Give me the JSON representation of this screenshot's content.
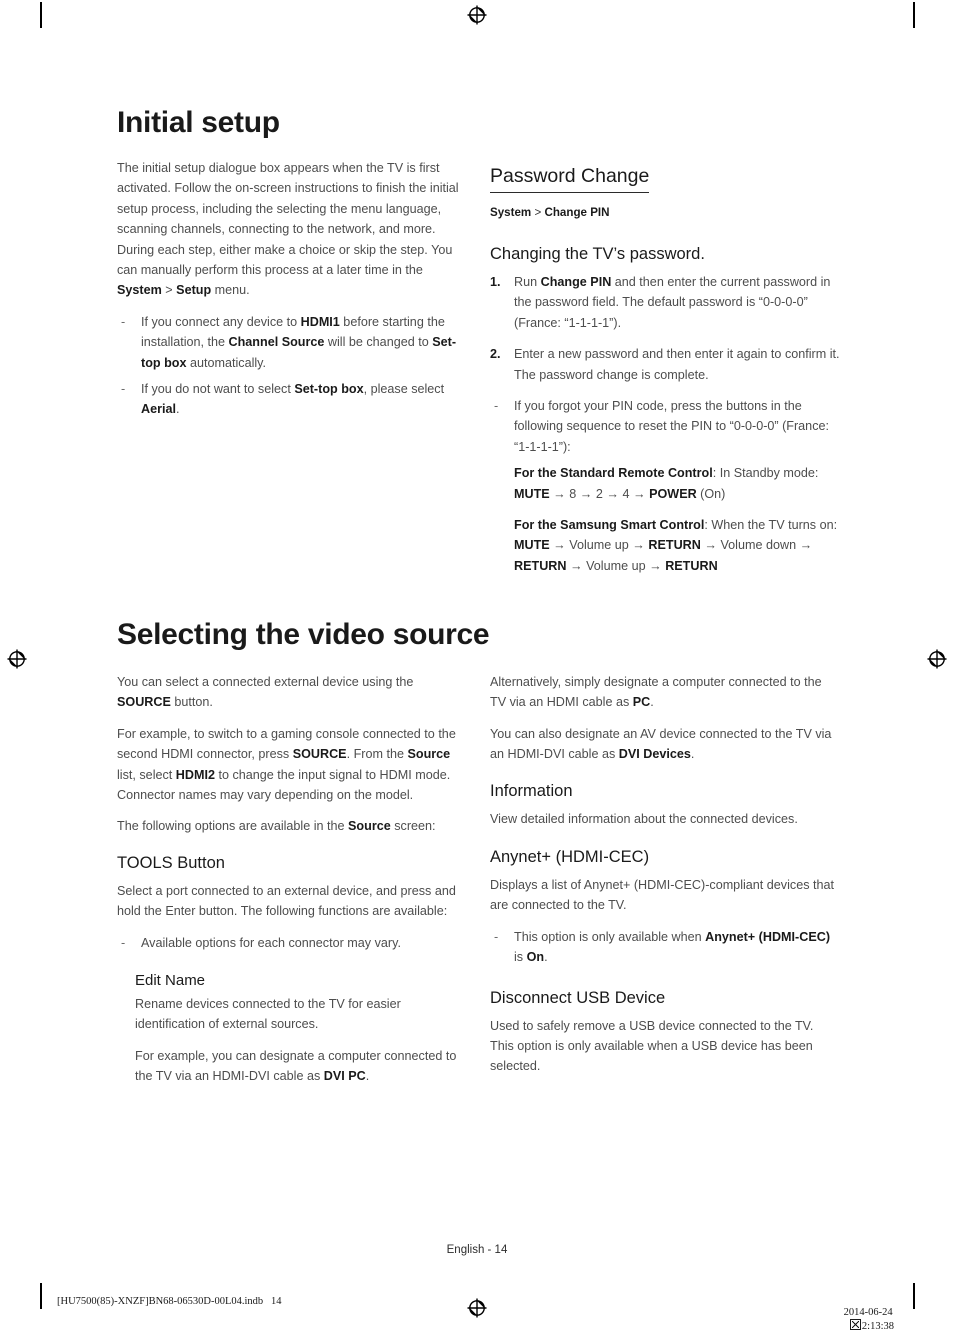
{
  "page": {
    "folio": "English - 14",
    "slug_left": "[HU7500(85)-XNZF]BN68-06530D-00L04.indb   14",
    "slug_right_date": "2014-06-24",
    "slug_right_time": "2:13:38"
  },
  "chapter1": {
    "title": "Initial setup",
    "intro": "The initial setup dialogue box appears when the TV is first activated. Follow the on-screen instructions to finish the initial setup process, including the selecting the menu language, scanning channels, connecting to the network, and more. During each step, either make a choice or skip the step. You can manually perform this process at a later time in the ",
    "intro_menu_1": "System",
    "intro_gt": " > ",
    "intro_menu_2": "Setup",
    "intro_tail": " menu.",
    "bullets": [
      {
        "marker": "-",
        "parts": [
          {
            "t": "If you connect any device to ",
            "b": false
          },
          {
            "t": "HDMI1",
            "b": true
          },
          {
            "t": " before starting the installation, the ",
            "b": false
          },
          {
            "t": "Channel Source",
            "b": true
          },
          {
            "t": " will be changed to ",
            "b": false
          },
          {
            "t": "Set-top box",
            "b": true
          },
          {
            "t": " automatically.",
            "b": false
          }
        ]
      },
      {
        "marker": "-",
        "parts": [
          {
            "t": "If you do not want to select ",
            "b": false
          },
          {
            "t": "Set-top box",
            "b": true
          },
          {
            "t": ", please select ",
            "b": false
          },
          {
            "t": "Aerial",
            "b": true
          },
          {
            "t": ".",
            "b": false
          }
        ]
      }
    ]
  },
  "password_change": {
    "heading": "Password Change",
    "path_root": "System",
    "path_sep": " > ",
    "path_leaf": "Change PIN",
    "sub_heading": "Changing the TV’s password.",
    "steps": [
      {
        "marker": "1.",
        "parts": [
          {
            "t": "Run ",
            "b": false
          },
          {
            "t": "Change PIN",
            "b": true
          },
          {
            "t": " and then enter the current password in the password field. The default password is “0-0-0-0” (France: “1-1-1-1”).",
            "b": false
          }
        ]
      },
      {
        "marker": "2.",
        "parts": [
          {
            "t": "Enter a new password and then enter it again to confirm it. The password change is complete.",
            "b": false
          }
        ]
      }
    ],
    "note": {
      "marker": "-",
      "text": "If you forgot your PIN code, press the buttons in the following sequence to reset the PIN to “0-0-0-0” (France: “1-1-1-1”):"
    },
    "remote_standard": {
      "label": "For the Standard Remote Control",
      "lead": ": In Standby mode:",
      "sequence_parts": [
        {
          "t": "MUTE",
          "b": true
        },
        {
          "t": " → ",
          "b": false
        },
        {
          "t": "8",
          "b": false
        },
        {
          "t": " → ",
          "b": false
        },
        {
          "t": "2",
          "b": false
        },
        {
          "t": " → ",
          "b": false
        },
        {
          "t": "4",
          "b": false
        },
        {
          "t": " → ",
          "b": false
        },
        {
          "t": "POWER",
          "b": true
        },
        {
          "t": " (On)",
          "b": false
        }
      ]
    },
    "remote_smart": {
      "label": "For the Samsung Smart Control",
      "lead": ": When the TV turns on: ",
      "sequence_parts": [
        {
          "t": "MUTE",
          "b": true
        },
        {
          "t": " → ",
          "b": false
        },
        {
          "t": "Volume up",
          "b": false
        },
        {
          "t": " → ",
          "b": false
        },
        {
          "t": "RETURN",
          "b": true
        },
        {
          "t": " → ",
          "b": false
        },
        {
          "t": "Volume down",
          "b": false
        },
        {
          "t": " → ",
          "b": false
        },
        {
          "t": "RETURN",
          "b": true
        },
        {
          "t": " → ",
          "b": false
        },
        {
          "t": "Volume up",
          "b": false
        },
        {
          "t": " → ",
          "b": false
        },
        {
          "t": "RETURN",
          "b": true
        }
      ]
    }
  },
  "chapter2": {
    "title": "Selecting the video source",
    "left": {
      "p1_parts": [
        {
          "t": "You can select a connected external device using the ",
          "b": false
        },
        {
          "t": "SOURCE",
          "b": true
        },
        {
          "t": " button.",
          "b": false
        }
      ],
      "p2_parts": [
        {
          "t": "For example, to switch to a gaming console connected to the second HDMI connector, press ",
          "b": false
        },
        {
          "t": "SOURCE",
          "b": true
        },
        {
          "t": ". From the ",
          "b": false
        },
        {
          "t": "Source",
          "b": true
        },
        {
          "t": " list, select ",
          "b": false
        },
        {
          "t": "HDMI2",
          "b": true
        },
        {
          "t": " to change the input signal to HDMI mode. Connector names may vary depending on the model.",
          "b": false
        }
      ],
      "p3_parts": [
        {
          "t": "The following options are available in the ",
          "b": false
        },
        {
          "t": "Source",
          "b": true
        },
        {
          "t": " screen:",
          "b": false
        }
      ],
      "tools_heading": "TOOLS Button",
      "tools_body": "Select a port connected to an external device, and press and hold the Enter button. The following functions are available:",
      "tools_bullet_marker": "-",
      "tools_bullet": "Available options for each connector may vary.",
      "edit_name_heading": "Edit Name",
      "edit_name_p1": "Rename devices connected to the TV for easier identification of external sources.",
      "edit_name_p2_parts": [
        {
          "t": "For example, you can designate a computer connected to the TV via an HDMI-DVI cable as ",
          "b": false
        },
        {
          "t": "DVI PC",
          "b": true
        },
        {
          "t": ".",
          "b": false
        }
      ]
    },
    "right": {
      "p1_parts": [
        {
          "t": "Alternatively, simply designate a computer connected to the TV via an HDMI cable as ",
          "b": false
        },
        {
          "t": "PC",
          "b": true
        },
        {
          "t": ".",
          "b": false
        }
      ],
      "p2_parts": [
        {
          "t": "You can also designate an AV device connected to the TV via an HDMI-DVI cable as ",
          "b": false
        },
        {
          "t": "DVI Devices",
          "b": true
        },
        {
          "t": ".",
          "b": false
        }
      ],
      "information_heading": "Information",
      "information_body": "View detailed information about the connected devices.",
      "anynet_heading": "Anynet+ (HDMI-CEC)",
      "anynet_body": "Displays a list of Anynet+ (HDMI-CEC)-compliant devices that are connected to the TV.",
      "anynet_bullet_marker": "-",
      "anynet_bullet_parts": [
        {
          "t": "This option is only available when ",
          "b": false
        },
        {
          "t": "Anynet+ (HDMI-CEC)",
          "b": true
        },
        {
          "t": " is ",
          "b": false
        },
        {
          "t": "On",
          "b": true
        },
        {
          "t": ".",
          "b": false
        }
      ],
      "usb_heading": "Disconnect USB Device",
      "usb_body": "Used to safely remove a USB device connected to the TV. This option is only available when a USB device has been selected."
    }
  }
}
